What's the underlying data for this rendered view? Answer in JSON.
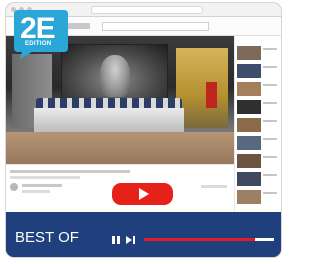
{
  "badge": {
    "number": "2E",
    "edition": "EDITION"
  },
  "player": {
    "label": "BEST OF",
    "progress_fraction": 0.85,
    "accent_color": "#e21b2c",
    "bar_color": "#1f3f7d",
    "play_button_color": "#e62117"
  },
  "icons": {
    "play": "play-icon",
    "pause": "pause-icon",
    "next": "skip-next-icon"
  }
}
